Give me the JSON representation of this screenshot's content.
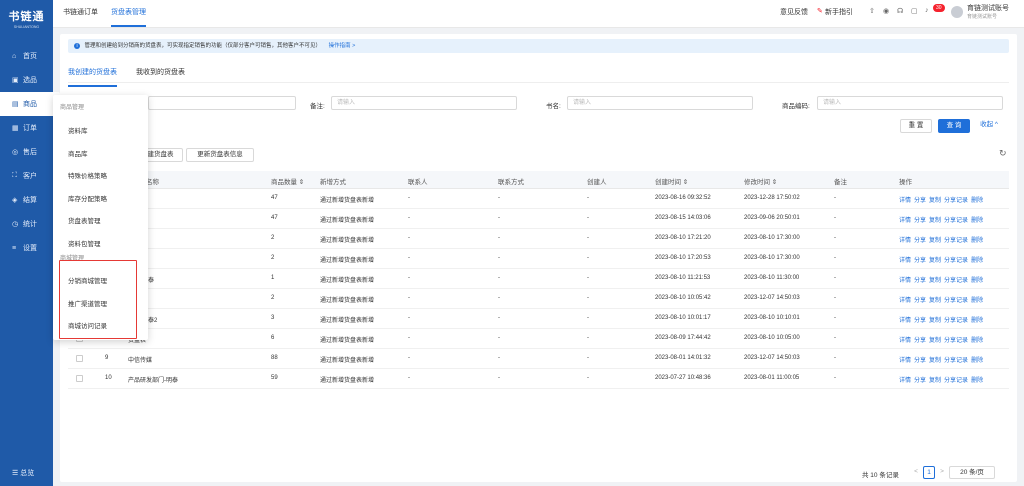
{
  "sidebar": {
    "logo_text": "书链通",
    "logo_sub": "SHULIANTONG",
    "items": [
      {
        "icon": "home-icon",
        "glyph": "⌂",
        "label": "首页"
      },
      {
        "icon": "select-icon",
        "glyph": "▣",
        "label": "选品"
      },
      {
        "icon": "goods-icon",
        "glyph": "▤",
        "label": "商品"
      },
      {
        "icon": "order-icon",
        "glyph": "▦",
        "label": "订单"
      },
      {
        "icon": "aftersale-icon",
        "glyph": "◎",
        "label": "售后"
      },
      {
        "icon": "customer-icon",
        "glyph": "⛶",
        "label": "客户"
      },
      {
        "icon": "settlement-icon",
        "glyph": "◈",
        "label": "结算"
      },
      {
        "icon": "stats-icon",
        "glyph": "◷",
        "label": "统计"
      },
      {
        "icon": "settings-icon",
        "glyph": "≡",
        "label": "设置"
      }
    ],
    "bottom": "☰ 总览"
  },
  "topbar": {
    "tabs": [
      "书链通订单",
      "货盘表管理"
    ],
    "feedback": "意见反馈",
    "guide": "新手指引",
    "badge": "30",
    "account_name": "育链测试账号",
    "account_sub": "育链测试账号"
  },
  "notice": {
    "icon": "i",
    "text": "管理和创建给到分销商的货盘表，可实现指定销售的功能（仅部分客户可销售，其他客户不可见）",
    "link": "操作指南 >"
  },
  "subtabs": [
    "我创建的货盘表",
    "我收到的货盘表"
  ],
  "filters": {
    "remark_label": "备注:",
    "remark_placeholder": "请输入",
    "bookname_label": "书名:",
    "bookname_placeholder": "请输入",
    "code_label": "商品编码:",
    "code_placeholder": "请输入"
  },
  "buttons": {
    "reset": "重 置",
    "query": "查 询",
    "collapse": "收起 ^",
    "create_partial": "建货盘表",
    "update": "更新货盘表信息"
  },
  "table": {
    "headers": [
      "名称",
      "商品数量 ⇕",
      "新增方式",
      "联系人",
      "联系方式",
      "创建人",
      "创建时间 ⇕",
      "修改时间 ⇕",
      "备注",
      "操作"
    ],
    "ops": [
      "详情",
      "分享",
      "复制",
      "分享记录",
      "删除"
    ],
    "rows": [
      {
        "idx": "",
        "name": "",
        "count": "47",
        "method": "通过新增货盘表新增",
        "contact": "-",
        "phone": "-",
        "creator": "-",
        "created": "2023-08-16 09:32:52",
        "modified": "2023-12-28 17:50:02",
        "remark": "-"
      },
      {
        "idx": "",
        "name": "24",
        "count": "47",
        "method": "通过新增货盘表新增",
        "contact": "-",
        "phone": "-",
        "creator": "-",
        "created": "2023-08-15 14:03:06",
        "modified": "2023-09-06 20:50:01",
        "remark": "-"
      },
      {
        "idx": "",
        "name": "",
        "count": "2",
        "method": "通过新增货盘表新增",
        "contact": "-",
        "phone": "-",
        "creator": "-",
        "created": "2023-08-10 17:21:20",
        "modified": "2023-08-10 17:30:00",
        "remark": "-"
      },
      {
        "idx": "",
        "name": "",
        "count": "2",
        "method": "通过新增货盘表新增",
        "contact": "-",
        "phone": "-",
        "creator": "-",
        "created": "2023-08-10 17:20:53",
        "modified": "2023-08-10 17:30:00",
        "remark": "-"
      },
      {
        "idx": "",
        "name": "部门-明泰",
        "count": "1",
        "method": "通过新增货盘表新增",
        "contact": "-",
        "phone": "-",
        "creator": "-",
        "created": "2023-08-10 11:21:53",
        "modified": "2023-08-10 11:30:00",
        "remark": "-"
      },
      {
        "idx": "",
        "name": "",
        "count": "2",
        "method": "通过新增货盘表新增",
        "contact": "-",
        "phone": "-",
        "creator": "-",
        "created": "2023-08-10 10:05:42",
        "modified": "2023-12-07 14:50:03",
        "remark": "-"
      },
      {
        "idx": "",
        "name": "部门-明泰2",
        "count": "3",
        "method": "通过新增货盘表新增",
        "contact": "-",
        "phone": "-",
        "creator": "-",
        "created": "2023-08-10 10:01:17",
        "modified": "2023-08-10 10:10:01",
        "remark": "-"
      },
      {
        "idx": "8",
        "name": "货盘表",
        "count": "6",
        "method": "通过新增货盘表新增",
        "contact": "-",
        "phone": "-",
        "creator": "-",
        "created": "2023-08-09 17:44:42",
        "modified": "2023-08-10 10:05:00",
        "remark": "-"
      },
      {
        "idx": "9",
        "name": "中信传媒",
        "count": "88",
        "method": "通过新增货盘表新增",
        "contact": "-",
        "phone": "-",
        "creator": "-",
        "created": "2023-08-01 14:01:32",
        "modified": "2023-12-07 14:50:03",
        "remark": "-"
      },
      {
        "idx": "10",
        "name": "产品研发部门-明泰",
        "count": "59",
        "method": "通过新增货盘表新增",
        "contact": "-",
        "phone": "-",
        "creator": "-",
        "created": "2023-07-27 10:48:36",
        "modified": "2023-08-01 11:00:05",
        "remark": "-"
      }
    ]
  },
  "popup": {
    "group1": "商品管理",
    "group1_items": [
      "资料库",
      "商品库",
      "特殊价格策略",
      "库存分配策略",
      "货盘表管理",
      "资料包管理"
    ],
    "group2": "商城管理",
    "group2_items": [
      "分销商城管理",
      "推广渠道管理",
      "商城访问记录"
    ]
  },
  "pagination": {
    "total": "共 10 条记录",
    "prev": "<",
    "page": "1",
    "next": ">",
    "size": "20 条/页"
  },
  "colors": {
    "primary": "#1f6fd9",
    "sidebar": "#1f5aa8",
    "highlight_box": "#e53935"
  }
}
